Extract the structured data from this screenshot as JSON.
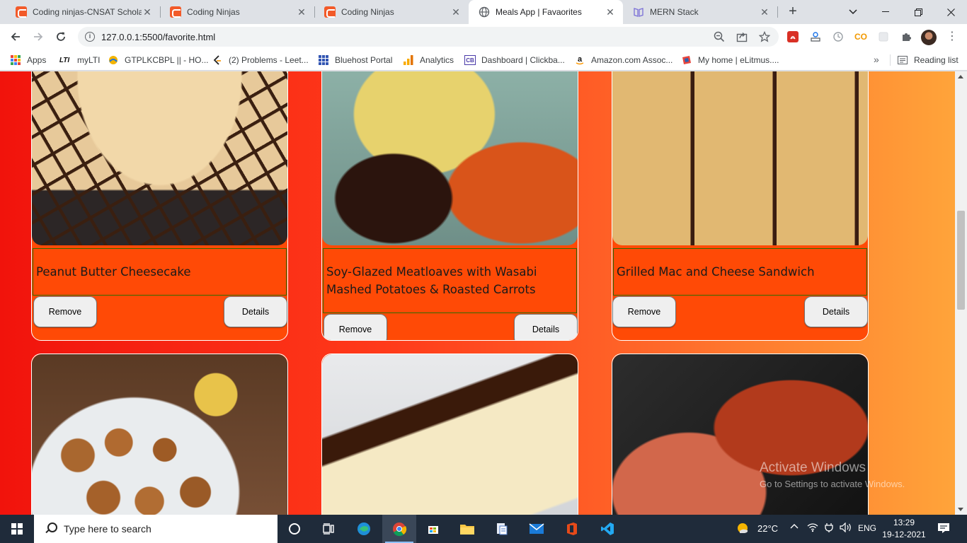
{
  "browser": {
    "tabs": [
      {
        "title": "Coding ninjas-CNSAT Scholar",
        "icon": "coding-ninjas-icon",
        "active": false
      },
      {
        "title": "Coding Ninjas",
        "icon": "coding-ninjas-icon",
        "active": false
      },
      {
        "title": "Coding Ninjas",
        "icon": "coding-ninjas-icon",
        "active": false
      },
      {
        "title": "Meals App | Favaorites",
        "icon": "globe-icon",
        "active": true
      },
      {
        "title": "MERN Stack",
        "icon": "book-icon",
        "active": false
      }
    ],
    "address": "127.0.0.1:5500/favorite.html"
  },
  "bookmarks": {
    "items": [
      {
        "label": "Apps",
        "icon": "apps-grid-icon"
      },
      {
        "label": "myLTI",
        "icon": "lti-icon"
      },
      {
        "label": "GTPLKCBPL || - HO...",
        "icon": "gtpl-icon"
      },
      {
        "label": "(2) Problems - Leet...",
        "icon": "leetcode-icon"
      },
      {
        "label": "Bluehost Portal",
        "icon": "bluehost-icon"
      },
      {
        "label": "Analytics",
        "icon": "analytics-icon"
      },
      {
        "label": "Dashboard | Clickba...",
        "icon": "clickbank-icon"
      },
      {
        "label": "Amazon.com Assoc...",
        "icon": "amazon-icon"
      },
      {
        "label": "My home | eLitmus....",
        "icon": "elitmus-icon"
      }
    ],
    "more": "»",
    "reading_list": "Reading list",
    "lti_badge": "LTI"
  },
  "meals": [
    {
      "name": "Peanut Butter Cheesecake",
      "remove": "Remove",
      "details": "Details"
    },
    {
      "name": "Soy-Glazed Meatloaves with Wasabi Mashed Potatoes & Roasted Carrots",
      "remove": "Remove",
      "details": "Details"
    },
    {
      "name": "Grilled Mac and Cheese Sandwich",
      "remove": "Remove",
      "details": "Details"
    }
  ],
  "watermark": {
    "line1": "Activate Windows",
    "line2": "Go to Settings to activate Windows."
  },
  "taskbar": {
    "search_placeholder": "Type here to search",
    "temperature": "22°C",
    "language": "ENG",
    "time": "13:29",
    "date": "19-12-2021"
  }
}
